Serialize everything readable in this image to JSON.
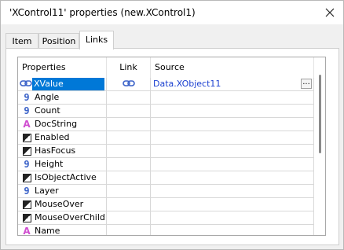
{
  "window": {
    "title": "'XControl11' properties (new.XControl1)"
  },
  "tabs": [
    {
      "label": "Item",
      "active": false
    },
    {
      "label": "Position",
      "active": false
    },
    {
      "label": "Links",
      "active": true
    }
  ],
  "grid": {
    "headers": {
      "properties": "Properties",
      "link": "Link",
      "source": "Source"
    },
    "rows": [
      {
        "name": "XValue",
        "icon": "link-icon",
        "link": true,
        "source": "Data.XObject11",
        "selected": true
      },
      {
        "name": "Angle",
        "icon": "numeric-icon"
      },
      {
        "name": "Count",
        "icon": "numeric-icon"
      },
      {
        "name": "DocString",
        "icon": "string-icon"
      },
      {
        "name": "Enabled",
        "icon": "boolean-icon"
      },
      {
        "name": "HasFocus",
        "icon": "boolean-icon"
      },
      {
        "name": "Height",
        "icon": "numeric-icon"
      },
      {
        "name": "IsObjectActive",
        "icon": "boolean-icon"
      },
      {
        "name": "Layer",
        "icon": "numeric-icon"
      },
      {
        "name": "MouseOver",
        "icon": "boolean-icon"
      },
      {
        "name": "MouseOverChild",
        "icon": "boolean-icon"
      },
      {
        "name": "Name",
        "icon": "string-icon"
      }
    ],
    "browse_label": "...",
    "glyphs": {
      "numeric": "9",
      "string": "A"
    }
  },
  "colors": {
    "selection": "#0078d7",
    "source_text": "#1a3fd0",
    "numeric_icon": "#3b62c8",
    "string_icon": "#d04fd0"
  }
}
